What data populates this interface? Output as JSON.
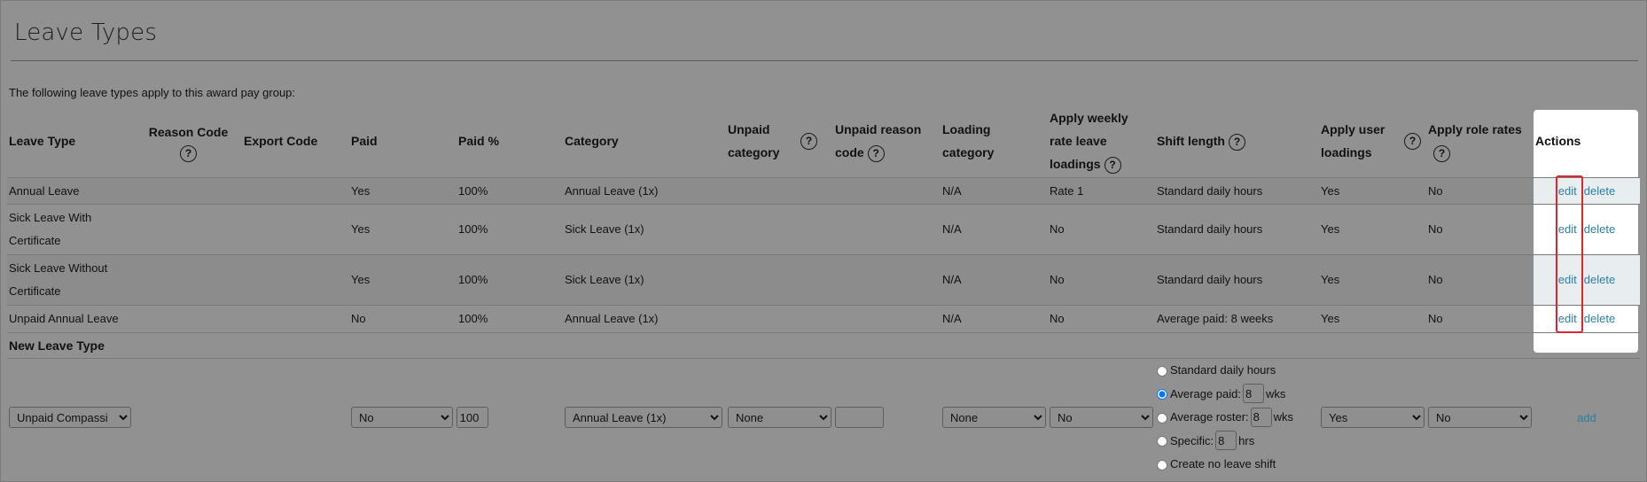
{
  "page": {
    "title": "Leave Types",
    "intro": "The following leave types apply to this award pay group:"
  },
  "table": {
    "headers": {
      "leave_type": "Leave Type",
      "reason_code": "Reason Code",
      "export_code": "Export Code",
      "paid": "Paid",
      "paid_pct": "Paid %",
      "category": "Category",
      "unpaid_category": "Unpaid category",
      "unpaid_reason_code": "Unpaid reason code",
      "loading_category": "Loading category",
      "apply_weekly": "Apply weekly rate leave loadings",
      "shift_length": "Shift length",
      "apply_user_loadings": "Apply user loadings",
      "apply_role_rates": "Apply role rates",
      "actions": "Actions"
    },
    "help_glyph": "?",
    "rows": [
      {
        "leave_type": "Annual Leave",
        "reason_code": "",
        "export_code": "",
        "paid": "Yes",
        "paid_pct": "100%",
        "category": "Annual Leave (1x)",
        "unpaid_category": "",
        "unpaid_reason_code": "",
        "loading_category": "N/A",
        "apply_weekly": "Rate 1",
        "shift_length": "Standard daily hours",
        "apply_user_loadings": "Yes",
        "apply_role_rates": "No"
      },
      {
        "leave_type": "Sick Leave With Certificate",
        "reason_code": "",
        "export_code": "",
        "paid": "Yes",
        "paid_pct": "100%",
        "category": "Sick Leave (1x)",
        "unpaid_category": "",
        "unpaid_reason_code": "",
        "loading_category": "N/A",
        "apply_weekly": "No",
        "shift_length": "Standard daily hours",
        "apply_user_loadings": "Yes",
        "apply_role_rates": "No"
      },
      {
        "leave_type": "Sick Leave Without Certificate",
        "reason_code": "",
        "export_code": "",
        "paid": "Yes",
        "paid_pct": "100%",
        "category": "Sick Leave (1x)",
        "unpaid_category": "",
        "unpaid_reason_code": "",
        "loading_category": "N/A",
        "apply_weekly": "No",
        "shift_length": "Standard daily hours",
        "apply_user_loadings": "Yes",
        "apply_role_rates": "No"
      },
      {
        "leave_type": "Unpaid Annual Leave",
        "reason_code": "",
        "export_code": "",
        "paid": "No",
        "paid_pct": "100%",
        "category": "Annual Leave (1x)",
        "unpaid_category": "",
        "unpaid_reason_code": "",
        "loading_category": "N/A",
        "apply_weekly": "No",
        "shift_length": "Average paid: 8 weeks",
        "apply_user_loadings": "Yes",
        "apply_role_rates": "No"
      }
    ],
    "action_edit": "edit",
    "action_delete": "delete"
  },
  "new_leave": {
    "section_title": "New Leave Type",
    "leave_type_value": "Unpaid Compassi",
    "paid_value": "No",
    "paid_pct_value": "100",
    "category_value": "Annual Leave (1x)",
    "unpaid_category_value": "None",
    "unpaid_reason_code_value": "",
    "loading_category_value": "None",
    "apply_weekly_value": "No",
    "shift_options": {
      "standard": "Standard daily hours",
      "average_paid": "Average paid:",
      "average_paid_value": "8",
      "average_paid_unit": "wks",
      "average_roster": "Average roster:",
      "average_roster_value": "8",
      "average_roster_unit": "wks",
      "specific": "Specific:",
      "specific_value": "8",
      "specific_unit": "hrs",
      "none": "Create no leave shift",
      "selected": "average_paid"
    },
    "apply_user_loadings_value": "Yes",
    "apply_role_rates_value": "No",
    "add_label": "add"
  },
  "colors": {
    "link": "#2a7fa6",
    "highlight": "#e0242b",
    "background": "#919191"
  }
}
